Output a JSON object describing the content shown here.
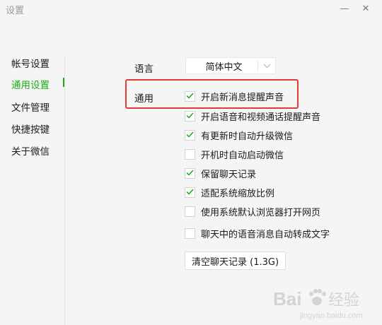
{
  "window": {
    "title": "设置"
  },
  "sidebar": {
    "items": [
      {
        "label": "帐号设置"
      },
      {
        "label": "通用设置"
      },
      {
        "label": "文件管理"
      },
      {
        "label": "快捷按键"
      },
      {
        "label": "关于微信"
      }
    ],
    "active_index": 1
  },
  "general": {
    "language_label": "语言",
    "language_value": "简体中文",
    "section_label": "通用",
    "options": [
      {
        "label": "开启新消息提醒声音",
        "checked": true
      },
      {
        "label": "开启语音和视频通话提醒声音",
        "checked": true
      },
      {
        "label": "有更新时自动升级微信",
        "checked": true
      },
      {
        "label": "开机时自动启动微信",
        "checked": false
      },
      {
        "label": "保留聊天记录",
        "checked": true
      },
      {
        "label": "适配系统缩放比例",
        "checked": true
      },
      {
        "label": "使用系统默认浏览器打开网页",
        "checked": false
      },
      {
        "label": "聊天中的语音消息自动转成文字",
        "checked": false
      }
    ],
    "clear_button_label": "清空聊天记录 (1.3G)"
  },
  "colors": {
    "accent": "#1aad19",
    "highlight": "#e53935"
  },
  "watermark": {
    "brand": "Bai",
    "suffix": "经验",
    "url": "jingyan.baidu.com"
  }
}
